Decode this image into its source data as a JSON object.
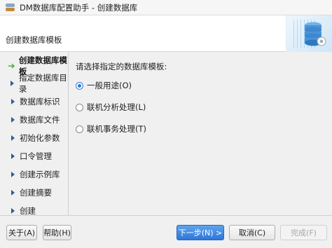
{
  "window": {
    "title": "DM数据库配置助手 - 创建数据库"
  },
  "header": {
    "title": "创建数据库模板",
    "art_icon": "database-icon"
  },
  "sidebar": {
    "items": [
      {
        "label": "创建数据库模板",
        "active": true
      },
      {
        "label": "指定数据库目录"
      },
      {
        "label": "数据库标识"
      },
      {
        "label": "数据库文件"
      },
      {
        "label": "初始化参数"
      },
      {
        "label": "口令管理"
      },
      {
        "label": "创建示例库"
      },
      {
        "label": "创建摘要"
      },
      {
        "label": "创建"
      }
    ]
  },
  "main": {
    "prompt": "请选择指定的数据库模板:",
    "options": [
      {
        "label": "一般用途(O)",
        "checked": true
      },
      {
        "label": "联机分析处理(L)",
        "checked": false
      },
      {
        "label": "联机事务处理(T)",
        "checked": false
      }
    ]
  },
  "footer": {
    "about": "关于(A)",
    "help": "帮助(H)",
    "next": "下一步(N) >",
    "cancel": "取消(C)",
    "finish": "完成(F)"
  },
  "colors": {
    "accent": "#2f74d0",
    "active_arrow": "#3aa935"
  }
}
